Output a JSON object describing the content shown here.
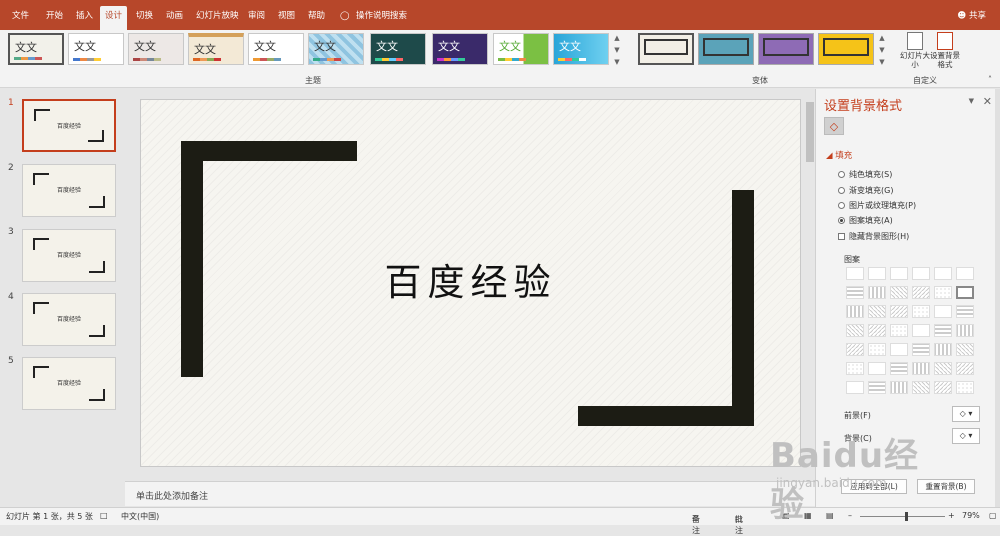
{
  "tabs": [
    "文件",
    "开始",
    "插入",
    "设计",
    "切换",
    "动画",
    "幻灯片放映",
    "审阅",
    "视图",
    "帮助"
  ],
  "search_hint": "操作说明搜索",
  "share": "共享",
  "theme_label": "文文",
  "group_theme": "主题",
  "group_variant": "变体",
  "group_custom": "自定义",
  "custom_btn1": "幻灯片大小",
  "custom_btn2": "设置背景格式",
  "slides": [
    {
      "num": "1",
      "text": "百度经验"
    },
    {
      "num": "2",
      "text": "百度经验"
    },
    {
      "num": "3",
      "text": "百度经验"
    },
    {
      "num": "4",
      "text": "百度经验"
    },
    {
      "num": "5",
      "text": "百度经验"
    }
  ],
  "slide_title": "百度经验",
  "notes_placeholder": "单击此处添加备注",
  "panel": {
    "title": "设置背景格式",
    "section": "填充",
    "options": [
      "纯色填充(S)",
      "渐变填充(G)",
      "图片或纹理填充(P)",
      "图案填充(A)"
    ],
    "selected_option": "图案填充(A)",
    "hide_bg": "隐藏背景图形(H)",
    "pattern_label": "图案",
    "foreground_label": "前景(F)",
    "background_label": "背景(C)",
    "apply_all": "应用到全部(L)",
    "reset_bg": "重置背景(B)"
  },
  "status": {
    "slide_info": "幻灯片 第 1 张，共 5 张",
    "language": "中文(中国)",
    "notes_btn": "备注",
    "comments_btn": "批注",
    "zoom": "79%"
  },
  "watermark": {
    "big": "Baidu经验",
    "small": "jingyan.baidu.com"
  },
  "colors": {
    "accent": "#b7472a",
    "bracket": "#1c1c14",
    "slide_bg": "#f6f5f0"
  }
}
